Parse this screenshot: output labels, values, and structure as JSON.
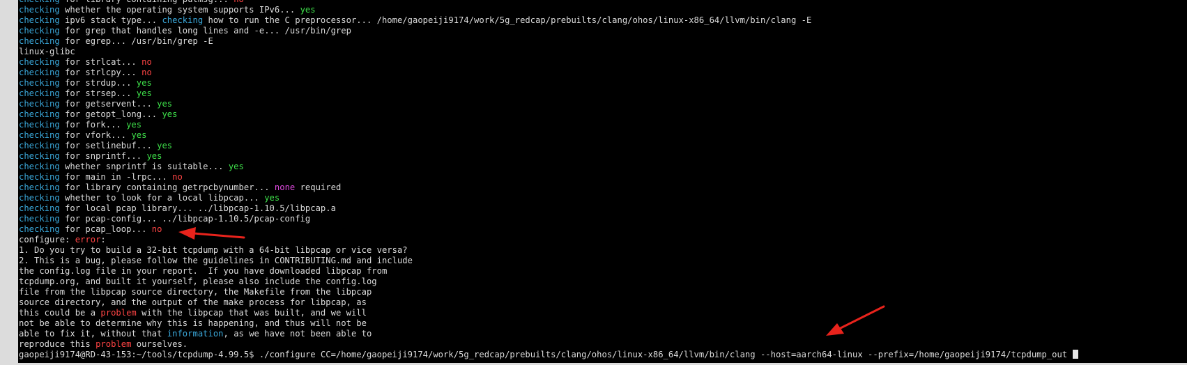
{
  "terminal": {
    "lines": [
      [
        {
          "t": "checking",
          "c": "blue"
        },
        {
          "t": " for library containing putmsg... "
        },
        {
          "t": "no",
          "c": "red"
        }
      ],
      [
        {
          "t": "checking",
          "c": "blue"
        },
        {
          "t": " whether the operating system supports IPv6... "
        },
        {
          "t": "yes",
          "c": "green"
        }
      ],
      [
        {
          "t": "checking",
          "c": "blue"
        },
        {
          "t": " ipv6 stack type... "
        },
        {
          "t": "checking",
          "c": "blue"
        },
        {
          "t": " how to run the C preprocessor... /home/gaopeiji9174/work/5g_redcap/prebuilts/clang/ohos/linux-x86_64/llvm/bin/clang -E"
        }
      ],
      [
        {
          "t": "checking",
          "c": "blue"
        },
        {
          "t": " for grep that handles long lines and -e... /usr/bin/grep"
        }
      ],
      [
        {
          "t": "checking",
          "c": "blue"
        },
        {
          "t": " for egrep... /usr/bin/grep -E"
        }
      ],
      [
        {
          "t": "linux-glibc"
        }
      ],
      [
        {
          "t": "checking",
          "c": "blue"
        },
        {
          "t": " for strlcat... "
        },
        {
          "t": "no",
          "c": "red"
        }
      ],
      [
        {
          "t": "checking",
          "c": "blue"
        },
        {
          "t": " for strlcpy... "
        },
        {
          "t": "no",
          "c": "red"
        }
      ],
      [
        {
          "t": "checking",
          "c": "blue"
        },
        {
          "t": " for strdup... "
        },
        {
          "t": "yes",
          "c": "green"
        }
      ],
      [
        {
          "t": "checking",
          "c": "blue"
        },
        {
          "t": " for strsep... "
        },
        {
          "t": "yes",
          "c": "green"
        }
      ],
      [
        {
          "t": "checking",
          "c": "blue"
        },
        {
          "t": " for getservent... "
        },
        {
          "t": "yes",
          "c": "green"
        }
      ],
      [
        {
          "t": "checking",
          "c": "blue"
        },
        {
          "t": " for getopt_long... "
        },
        {
          "t": "yes",
          "c": "green"
        }
      ],
      [
        {
          "t": "checking",
          "c": "blue"
        },
        {
          "t": " for fork... "
        },
        {
          "t": "yes",
          "c": "green"
        }
      ],
      [
        {
          "t": "checking",
          "c": "blue"
        },
        {
          "t": " for vfork... "
        },
        {
          "t": "yes",
          "c": "green"
        }
      ],
      [
        {
          "t": "checking",
          "c": "blue"
        },
        {
          "t": " for setlinebuf... "
        },
        {
          "t": "yes",
          "c": "green"
        }
      ],
      [
        {
          "t": "checking",
          "c": "blue"
        },
        {
          "t": " for snprintf... "
        },
        {
          "t": "yes",
          "c": "green"
        }
      ],
      [
        {
          "t": "checking",
          "c": "blue"
        },
        {
          "t": " whether snprintf is suitable... "
        },
        {
          "t": "yes",
          "c": "green"
        }
      ],
      [
        {
          "t": "checking",
          "c": "blue"
        },
        {
          "t": " for main in -lrpc... "
        },
        {
          "t": "no",
          "c": "red"
        }
      ],
      [
        {
          "t": "checking",
          "c": "blue"
        },
        {
          "t": " for library containing getrpcbynumber... "
        },
        {
          "t": "none",
          "c": "magenta"
        },
        {
          "t": " required"
        }
      ],
      [
        {
          "t": "checking",
          "c": "blue"
        },
        {
          "t": " whether to look for a local libpcap... "
        },
        {
          "t": "yes",
          "c": "green"
        }
      ],
      [
        {
          "t": "checking",
          "c": "blue"
        },
        {
          "t": " for local pcap library... ../libpcap-1.10.5/libpcap.a"
        }
      ],
      [
        {
          "t": "checking",
          "c": "blue"
        },
        {
          "t": " for pcap-config... ../libpcap-1.10.5/pcap-config"
        }
      ],
      [
        {
          "t": "checking",
          "c": "blue"
        },
        {
          "t": " for pcap_loop... "
        },
        {
          "t": "no",
          "c": "red"
        }
      ],
      [
        {
          "t": "configure: "
        },
        {
          "t": "error",
          "c": "red"
        },
        {
          "t": ":"
        }
      ],
      [
        {
          "t": "1. Do you try to build a 32-bit tcpdump with a 64-bit libpcap or vice versa?"
        }
      ],
      [
        {
          "t": "2. This is a bug, please follow the guidelines in CONTRIBUTING.md and include"
        }
      ],
      [
        {
          "t": "the config.log file in your report.  If you have downloaded libpcap from"
        }
      ],
      [
        {
          "t": "tcpdump.org, and built it yourself, please also include the config.log"
        }
      ],
      [
        {
          "t": "file from the libpcap source directory, the Makefile from the libpcap"
        }
      ],
      [
        {
          "t": "source directory, and the output of the make process for libpcap, as"
        }
      ],
      [
        {
          "t": "this could be a "
        },
        {
          "t": "problem",
          "c": "red"
        },
        {
          "t": " with the libpcap that was built, and we will"
        }
      ],
      [
        {
          "t": "not be able to determine why this is happening, and thus will not be"
        }
      ],
      [
        {
          "t": "able to fix it, without that "
        },
        {
          "t": "information",
          "c": "blue"
        },
        {
          "t": ", as we have not been able to"
        }
      ],
      [
        {
          "t": "reproduce this "
        },
        {
          "t": "problem",
          "c": "red"
        },
        {
          "t": " ourselves."
        }
      ]
    ],
    "prompt": "gaopeiji9174@RD-43-153:~/tools/tcpdump-4.99.5$ ",
    "command": "./configure CC=/home/gaopeiji9174/work/5g_redcap/prebuilts/clang/ohos/linux-x86_64/llvm/bin/clang --host=aarch64-linux --prefix=/home/gaopeiji9174/tcpdump_out "
  },
  "colors": {
    "background": "#000000",
    "text": "#dcdcdc",
    "blue": "#3aa7d9",
    "green": "#3ee04a",
    "red": "#ff4444",
    "magenta": "#e04ae0",
    "annotation_arrow": "#e8231c"
  }
}
